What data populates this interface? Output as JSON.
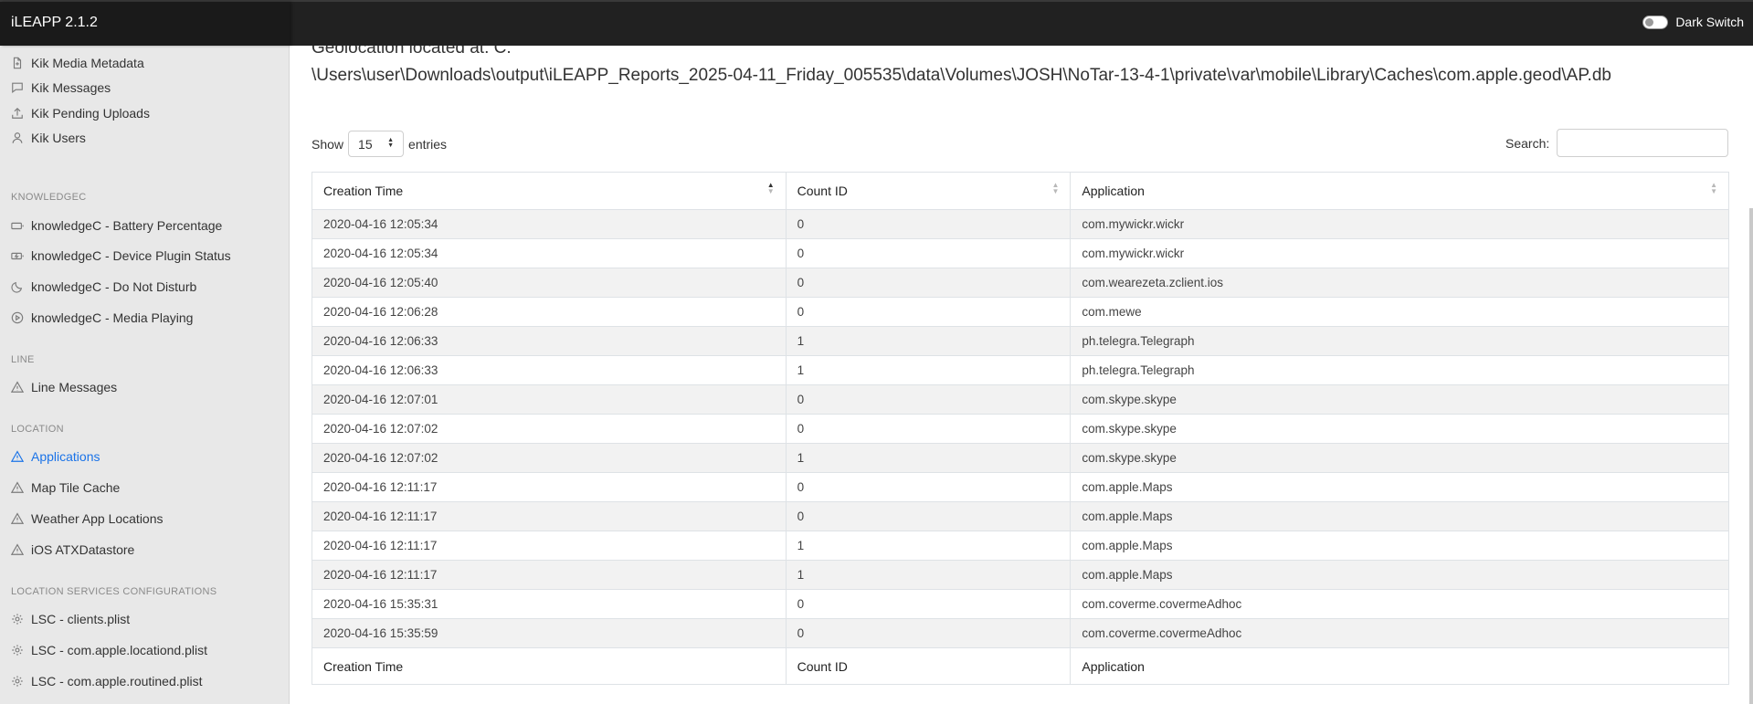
{
  "app": {
    "title": "iLEAPP 2.1.2",
    "dark_switch_label": "Dark Switch"
  },
  "sidebar": {
    "kik_items": [
      "Kik Media Metadata",
      "Kik Messages",
      "Kik Pending Uploads",
      "Kik Users"
    ],
    "knowledgec_header": "KNOWLEDGEC",
    "knowledgec_items": [
      "knowledgeC - Battery Percentage",
      "knowledgeC - Device Plugin Status",
      "knowledgeC - Do Not Disturb",
      "knowledgeC - Media Playing"
    ],
    "line_header": "LINE",
    "line_items": [
      "Line Messages"
    ],
    "location_header": "LOCATION",
    "location_items": [
      "Applications",
      "Map Tile Cache",
      "Weather App Locations",
      "iOS ATXDatastore"
    ],
    "lsc_header": "LOCATION SERVICES CONFIGURATIONS",
    "lsc_items": [
      "LSC - clients.plist",
      "LSC - com.apple.locationd.plist",
      "LSC - com.apple.routined.plist"
    ]
  },
  "main": {
    "geo_line1": "Geolocation located at: C:",
    "geo_line2": "\\Users\\user\\Downloads\\output\\iLEAPP_Reports_2025-04-11_Friday_005535\\data\\Volumes\\JOSH\\NoTar-13-4-1\\private\\var\\mobile\\Library\\Caches\\com.apple.geod\\AP.db",
    "show_label": "Show",
    "entries_value": "15",
    "entries_label": "entries",
    "search_label": "Search:",
    "columns": [
      "Creation Time",
      "Count ID",
      "Application"
    ],
    "rows": [
      [
        "2020-04-16 12:05:34",
        "0",
        "com.mywickr.wickr"
      ],
      [
        "2020-04-16 12:05:34",
        "0",
        "com.mywickr.wickr"
      ],
      [
        "2020-04-16 12:05:40",
        "0",
        "com.wearezeta.zclient.ios"
      ],
      [
        "2020-04-16 12:06:28",
        "0",
        "com.mewe"
      ],
      [
        "2020-04-16 12:06:33",
        "1",
        "ph.telegra.Telegraph"
      ],
      [
        "2020-04-16 12:06:33",
        "1",
        "ph.telegra.Telegraph"
      ],
      [
        "2020-04-16 12:07:01",
        "0",
        "com.skype.skype"
      ],
      [
        "2020-04-16 12:07:02",
        "0",
        "com.skype.skype"
      ],
      [
        "2020-04-16 12:07:02",
        "1",
        "com.skype.skype"
      ],
      [
        "2020-04-16 12:11:17",
        "0",
        "com.apple.Maps"
      ],
      [
        "2020-04-16 12:11:17",
        "0",
        "com.apple.Maps"
      ],
      [
        "2020-04-16 12:11:17",
        "1",
        "com.apple.Maps"
      ],
      [
        "2020-04-16 12:11:17",
        "1",
        "com.apple.Maps"
      ],
      [
        "2020-04-16 15:35:31",
        "0",
        "com.coverme.covermeAdhoc"
      ],
      [
        "2020-04-16 15:35:59",
        "0",
        "com.coverme.covermeAdhoc"
      ]
    ]
  },
  "colors": {
    "accent": "#1a73e8",
    "navbar": "#212121",
    "sidebar": "#e8e8e8"
  }
}
